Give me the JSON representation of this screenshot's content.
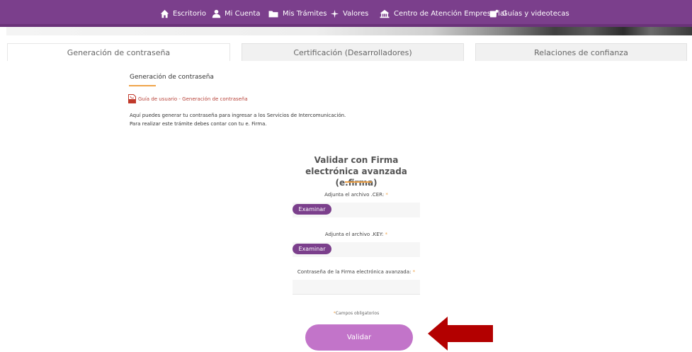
{
  "nav": {
    "items": [
      {
        "label": "Escritorio",
        "icon": "home-icon"
      },
      {
        "label": "Mi Cuenta",
        "icon": "user-icon"
      },
      {
        "label": "Mis Trámites",
        "icon": "folder-icon"
      },
      {
        "label": "Valores",
        "icon": "sparkle-icon"
      },
      {
        "label": "Centro de Atención Empresarial",
        "icon": "building-icon"
      },
      {
        "label": "Guías y videotecas",
        "icon": "video-guide-icon"
      }
    ]
  },
  "tabs": [
    {
      "label": "Generación de contraseña",
      "active": true
    },
    {
      "label": "Certificación (Desarrolladores)",
      "active": false
    },
    {
      "label": "Relaciones de confianza",
      "active": false
    }
  ],
  "content": {
    "section_title": "Generación de contraseña",
    "guide_link": "Guía de usuario - Generación de contraseña",
    "info_line1": "Aquí puedes generar tu contraseña para ingresar a los Servicios de Intercomunicación.",
    "info_line2": "Para realizar este trámite debes contar con tu e. Firma."
  },
  "form": {
    "title": "Validar con Firma electrónica avanzada (e.firma)",
    "cer_label": "Adjunta el archivo .CER:",
    "key_label": "Adjunta el archivo .KEY:",
    "password_label": "Contraseña de la Firma electrónica avanzada:",
    "required_mark": "*",
    "browse_label": "Examinar",
    "required_note": "Campos obligatorios",
    "submit_label": "Validar"
  },
  "colors": {
    "nav_bg": "#7b3f8c",
    "accent_orange": "#f0a44a",
    "submit_bg": "#c274c9",
    "pdf_red": "#b8443b",
    "arrow_red": "#b30000"
  }
}
